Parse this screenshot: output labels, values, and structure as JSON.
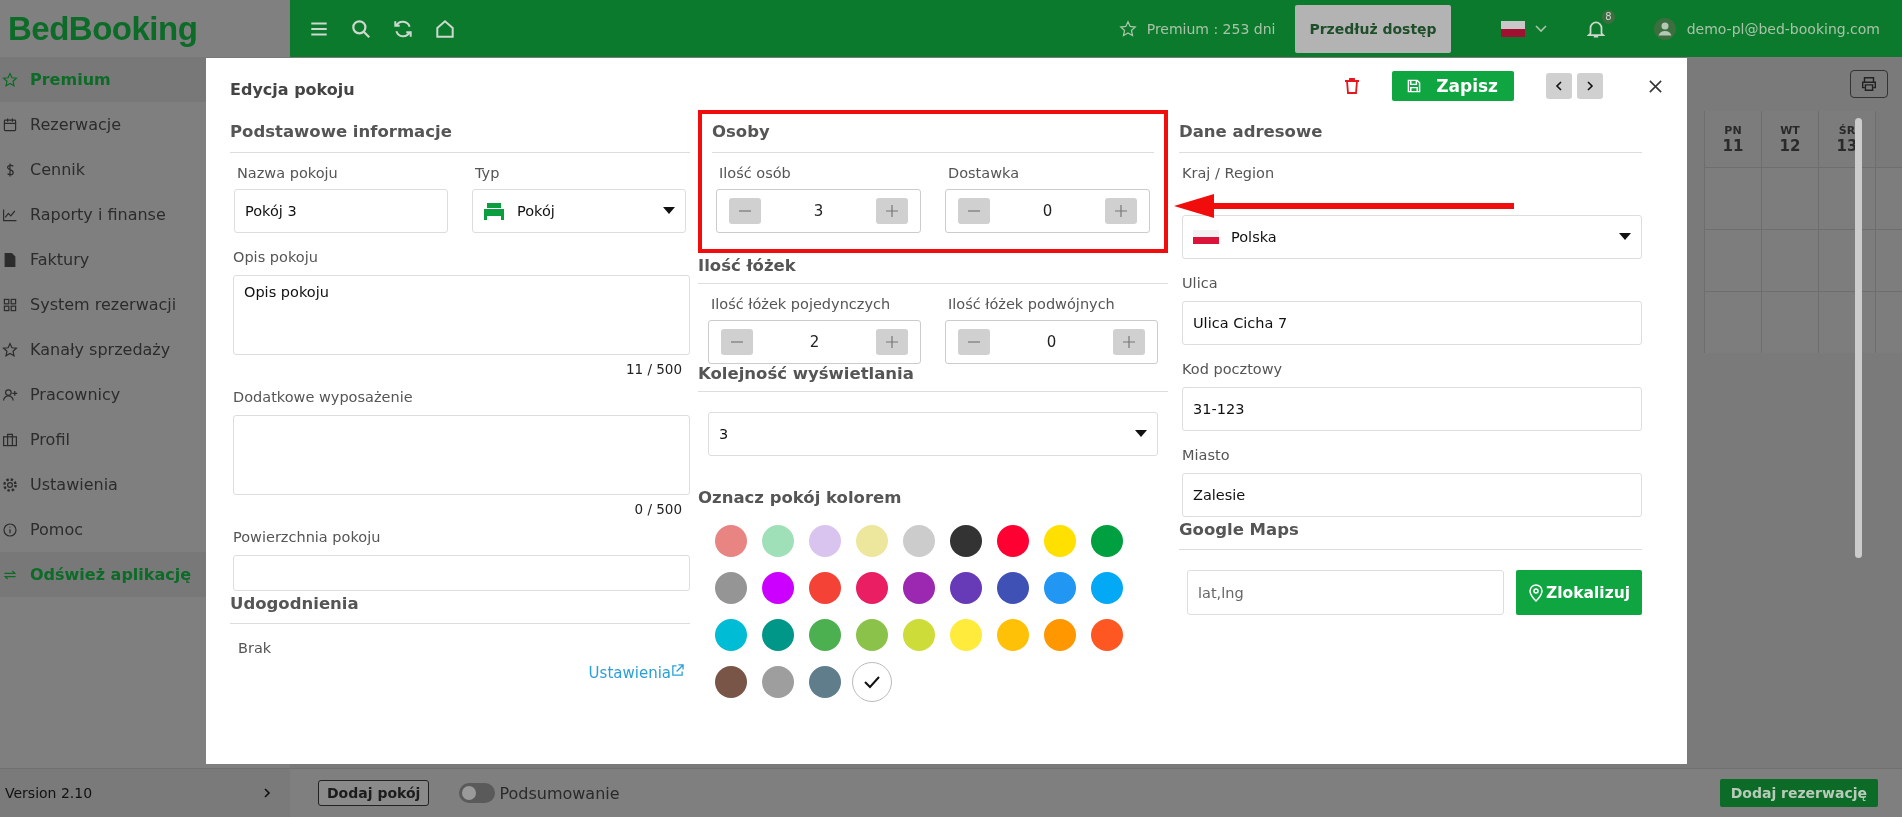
{
  "app": {
    "logo": "BedBooking"
  },
  "topbar": {
    "premium": "Premium : 253 dni",
    "extend_button": "Przedłuż dostęp",
    "notifications": "8",
    "user": "demo-pl@bed-booking.com"
  },
  "sidebar": {
    "items": [
      {
        "label": "Premium",
        "kind": "star",
        "selected": true
      },
      {
        "label": "Rezerwacje",
        "kind": "calendar",
        "selected": false
      },
      {
        "label": "Cennik",
        "kind": "dollar",
        "selected": false
      },
      {
        "label": "Raporty i finanse",
        "kind": "chart",
        "selected": false
      },
      {
        "label": "Faktury",
        "kind": "invoice",
        "selected": false
      },
      {
        "label": "System rezerwacji",
        "kind": "grid",
        "selected": false
      },
      {
        "label": "Kanały sprzedaży",
        "kind": "star",
        "selected": false
      },
      {
        "label": "Pracownicy",
        "kind": "user-plus",
        "selected": false
      },
      {
        "label": "Profil",
        "kind": "briefcase",
        "selected": false
      },
      {
        "label": "Ustawienia",
        "kind": "gear",
        "selected": false
      },
      {
        "label": "Pomoc",
        "kind": "info",
        "selected": false
      },
      {
        "label": "Odśwież aplikację",
        "kind": "refresh",
        "selected": true
      }
    ],
    "version": "Version 2.10"
  },
  "calendar": {
    "days": [
      {
        "day": "PN",
        "date": "11"
      },
      {
        "day": "WT",
        "date": "12"
      },
      {
        "day": "ŚR",
        "date": "13"
      }
    ]
  },
  "modal": {
    "title": "Edycja pokoju",
    "save_button": "Zapisz",
    "basic": {
      "heading": "Podstawowe informacje",
      "name_label": "Nazwa pokoju",
      "name_value": "Pokój 3",
      "type_label": "Typ",
      "type_value": "Pokój",
      "description_label": "Opis pokoju",
      "description_value": "Opis pokoju",
      "description_counter": "11 / 500",
      "equipment_label": "Dodatkowe wyposażenie",
      "equipment_counter": "0 / 500",
      "area_label": "Powierzchnia pokoju",
      "amenities_heading": "Udogodnienia",
      "amenities_value": "Brak",
      "settings_link": "Ustawienia"
    },
    "persons": {
      "heading": "Osoby",
      "highlighted": true,
      "steppers": [
        {
          "label": "Ilość osób",
          "value": "3"
        },
        {
          "label": "Dostawka",
          "value": "0"
        }
      ]
    },
    "beds": {
      "heading": "Ilość łóżek",
      "steppers": [
        {
          "label": "Ilość łóżek pojedynczych",
          "value": "2"
        },
        {
          "label": "Ilość łóżek podwójnych",
          "value": "0"
        }
      ]
    },
    "order": {
      "heading": "Kolejność wyświetlania",
      "value": "3"
    },
    "colors": {
      "heading": "Oznacz pokój kolorem",
      "swatches": [
        {
          "color": "#e88482",
          "selected": false
        },
        {
          "color": "#a0e0b8",
          "selected": false
        },
        {
          "color": "#d9c4ef",
          "selected": false
        },
        {
          "color": "#ede79e",
          "selected": false
        },
        {
          "color": "#cccccc",
          "selected": false
        },
        {
          "color": "#333333",
          "selected": false
        },
        {
          "color": "#ff0033",
          "selected": false
        },
        {
          "color": "#ffe000",
          "selected": false
        },
        {
          "color": "#00a040",
          "selected": false
        },
        {
          "color": "#959595",
          "selected": false
        },
        {
          "color": "#cc00ff",
          "selected": false
        },
        {
          "color": "#f44336",
          "selected": false
        },
        {
          "color": "#e91e63",
          "selected": false
        },
        {
          "color": "#9c27b0",
          "selected": false
        },
        {
          "color": "#673ab7",
          "selected": false
        },
        {
          "color": "#3f51b5",
          "selected": false
        },
        {
          "color": "#2196f3",
          "selected": false
        },
        {
          "color": "#03a9f4",
          "selected": false
        },
        {
          "color": "#00bcd4",
          "selected": false
        },
        {
          "color": "#009688",
          "selected": false
        },
        {
          "color": "#4caf50",
          "selected": false
        },
        {
          "color": "#8bc34a",
          "selected": false
        },
        {
          "color": "#cddc39",
          "selected": false
        },
        {
          "color": "#ffeb3b",
          "selected": false
        },
        {
          "color": "#ffc107",
          "selected": false
        },
        {
          "color": "#ff9800",
          "selected": false
        },
        {
          "color": "#ff5722",
          "selected": false
        },
        {
          "color": "#795548",
          "selected": false
        },
        {
          "color": "#9e9e9e",
          "selected": false
        },
        {
          "color": "#607d8b",
          "selected": false
        },
        {
          "color": "#ffffff",
          "selected": true
        }
      ]
    },
    "address": {
      "heading": "Dane adresowe",
      "country_label": "Kraj / Region",
      "country_value": "Polska",
      "street_label": "Ulica",
      "street_value": "Ulica Cicha 7",
      "postal_label": "Kod pocztowy",
      "postal_value": "31-123",
      "city_label": "Miasto",
      "city_value": "Zalesie",
      "maps_heading": "Google Maps",
      "coords_placeholder": "lat,lng",
      "locate_button": "Zlokalizuj"
    }
  },
  "bottom_bar": {
    "add_room": "Dodaj pokój",
    "summary_label": "Podsumowanie",
    "summary_on": false,
    "add_reservation": "Dodaj rezerwację"
  }
}
